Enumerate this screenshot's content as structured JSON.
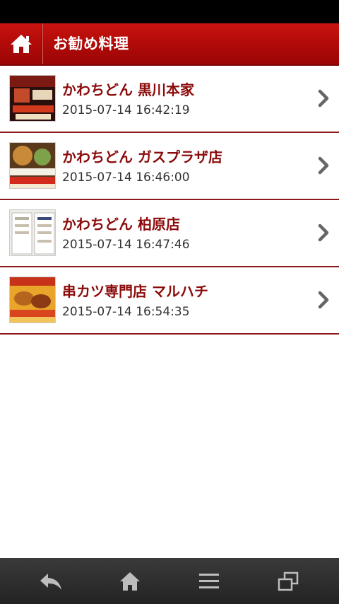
{
  "header": {
    "title": "お勧め料理"
  },
  "items": [
    {
      "title": "かわちどん 黒川本家",
      "date": "2015-07-14 16:42:19"
    },
    {
      "title": "かわちどん ガスプラザ店",
      "date": "2015-07-14 16:46:00"
    },
    {
      "title": "かわちどん 柏原店",
      "date": "2015-07-14 16:47:46"
    },
    {
      "title": "串カツ専門店 マルハチ",
      "date": "2015-07-14 16:54:35"
    }
  ],
  "colors": {
    "header_red": "#b10a08",
    "title_red": "#8b0b0b",
    "divider": "#8b1a1a",
    "nav_bg": "#2a2a2a"
  },
  "icons": {
    "home": "home-icon",
    "chevron": "chevron-right-icon",
    "back": "back-arrow-icon",
    "menu": "menu-icon",
    "recents": "recent-apps-icon"
  }
}
